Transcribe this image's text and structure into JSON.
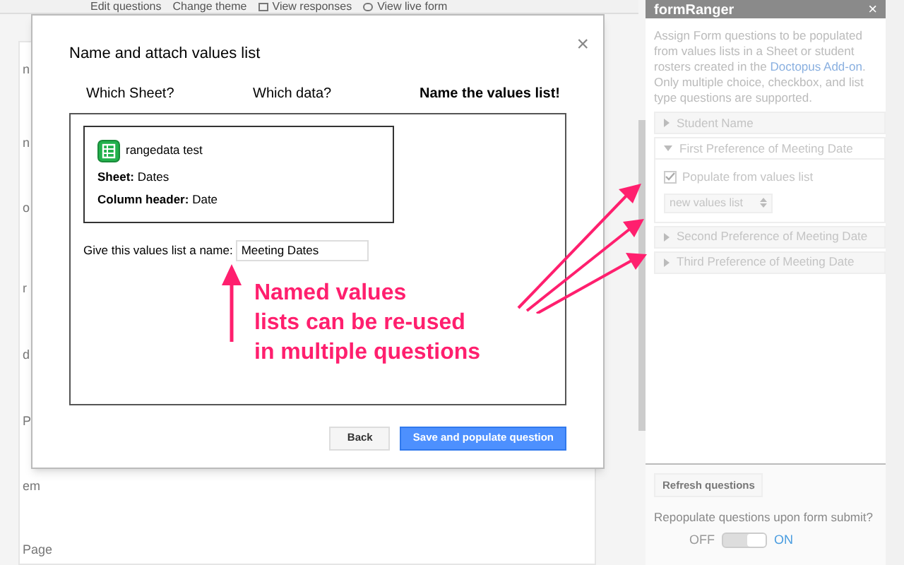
{
  "toolbar": {
    "items": [
      {
        "label": "Edit questions"
      },
      {
        "label": "Change theme"
      },
      {
        "label": "View responses"
      },
      {
        "label": "View live form"
      }
    ]
  },
  "form_background": {
    "fragments": [
      "n",
      "n",
      "o",
      "r",
      "d",
      "P",
      "em",
      "Page"
    ]
  },
  "dialog": {
    "title": "Name and attach values list",
    "close": "×",
    "steps": [
      {
        "label": "Which Sheet?",
        "selected": false
      },
      {
        "label": "Which data?",
        "selected": false
      },
      {
        "label": "Name the values list!",
        "selected": true
      }
    ],
    "source": {
      "name": "rangedata test",
      "details": [
        {
          "label": "Sheet:",
          "value": "Dates"
        },
        {
          "label": "Column header:",
          "value": "Date"
        }
      ]
    },
    "name_field": {
      "label": "Give this values list a name:",
      "value": "Meeting Dates"
    },
    "buttons": [
      {
        "label": "Back",
        "kind": "secondary"
      },
      {
        "label": "Save and populate question",
        "kind": "primary"
      }
    ]
  },
  "annotation": {
    "lines": [
      "Named values",
      "lists can be re-used",
      "in multiple questions"
    ]
  },
  "sidebar": {
    "title": "formRanger",
    "close": "×",
    "intro": "Assign Form questions to be populated from values lists in a Sheet or student rosters created in the **Doctopus Add-on**. Only multiple choice, checkbox, and list type questions are supported.",
    "questions": [
      {
        "label": "Student Name",
        "expanded": false
      },
      {
        "label": "First Preference of Meeting Date",
        "expanded": true,
        "populate": {
          "label": "Populate from values list",
          "checked": true
        },
        "select": "new values list"
      },
      {
        "label": "Second Preference of Meeting Date",
        "expanded": false
      },
      {
        "label": "Third Preference of Meeting Date",
        "expanded": false
      }
    ],
    "refresh_button": "Refresh questions",
    "repopulate": {
      "label": "Repopulate questions upon form submit?",
      "off_label": "OFF",
      "on_label": "ON",
      "on": true
    }
  }
}
